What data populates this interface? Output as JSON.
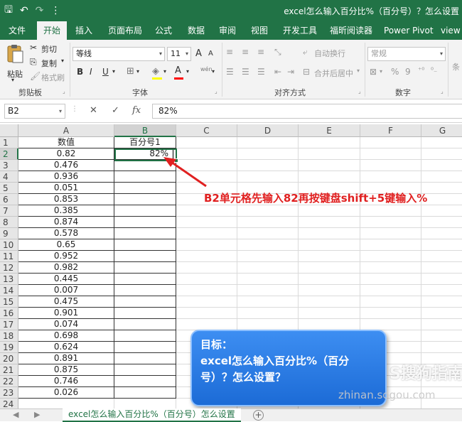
{
  "window": {
    "title": "excel怎么输入百分比%（百分号）？怎么设置",
    "quick_access": {
      "save": "🖫",
      "undo": "↶",
      "redo": "↷",
      "customize": "⋮"
    }
  },
  "ribbon_tabs": [
    "文件",
    "开始",
    "插入",
    "页面布局",
    "公式",
    "数据",
    "审阅",
    "视图",
    "开发工具",
    "福昕阅读器",
    "Power Pivot",
    "view"
  ],
  "active_tab": "开始",
  "clipboard": {
    "paste": "粘贴",
    "cut": "剪切",
    "copy": "复制",
    "format_painter": "格式刷",
    "label": "剪贴板"
  },
  "font": {
    "name": "等线",
    "size": "11",
    "grow": "A",
    "shrink": "A",
    "bold": "B",
    "italic": "I",
    "underline": "U",
    "wen": "wén",
    "color_a": "A",
    "label": "字体"
  },
  "alignment": {
    "wrap": "自动换行",
    "merge": "合并后居中",
    "label": "对齐方式"
  },
  "number": {
    "format": "常规",
    "percent": "%",
    "comma": "9",
    "label": "数字"
  },
  "styles": {
    "partial": "条"
  },
  "formula_bar": {
    "name_box": "B2",
    "cancel": "✕",
    "enter": "✓",
    "fx": "fx",
    "value": "82%"
  },
  "columns": [
    "A",
    "B",
    "C",
    "D",
    "E",
    "F",
    "G"
  ],
  "rows": [
    "1",
    "2",
    "3",
    "4",
    "5",
    "6",
    "7",
    "8",
    "9",
    "10",
    "11",
    "12",
    "13",
    "14",
    "15",
    "16",
    "17",
    "18",
    "19",
    "20",
    "21",
    "22",
    "23",
    "24"
  ],
  "table": {
    "header_a": "数值",
    "header_b": "百分号1",
    "values": [
      "0.82",
      "0.476",
      "0.936",
      "0.051",
      "0.853",
      "0.385",
      "0.874",
      "0.578",
      "0.65",
      "0.952",
      "0.982",
      "0.445",
      "0.007",
      "0.475",
      "0.901",
      "0.074",
      "0.698",
      "0.624",
      "0.891",
      "0.875",
      "0.746",
      "0.026"
    ],
    "b2": "82%"
  },
  "annotation": "B2单元格先输入82再按键盘shift+5键输入%",
  "goal_box": {
    "line1": "目标：",
    "line2": "excel怎么输入百分比%（百分",
    "line3": "号）？怎么设置？"
  },
  "watermark": {
    "logo": "S搜狗指南",
    "url": "zhinan.sogou.com"
  },
  "sheet_tab": "excel怎么输入百分比%（百分号）怎么设置",
  "sheet_add": "+",
  "sheet_nav": {
    "prev": "◀",
    "next": "▶"
  },
  "colors": {
    "excel_green": "#217346",
    "annotation_red": "#e02020",
    "goal_blue": "#2a7be4"
  }
}
